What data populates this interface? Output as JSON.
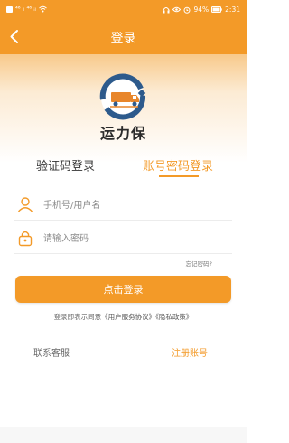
{
  "status_bar": {
    "signal_text": "⁴⁶ ᵢₗ ⁴⁶ ᵢₗ",
    "battery": "94%",
    "time": "2:31"
  },
  "nav": {
    "title": "登录",
    "back_icon": "chevron-left-icon"
  },
  "brand": {
    "app_name": "运力保",
    "logo_icon": "truck-logo-icon"
  },
  "tabs": {
    "code_login": "验证码登录",
    "password_login": "账号密码登录",
    "active": "password_login"
  },
  "form": {
    "phone_placeholder": "手机号/用户名",
    "phone_value": "",
    "password_placeholder": "请输入密码",
    "password_value": "",
    "forgot_password": "忘记密码?",
    "login_button": "点击登录"
  },
  "agreement": {
    "prefix": "登录即表示同意",
    "user_agreement": "《用户服务协议》",
    "privacy_policy": "《隐私政策》"
  },
  "footer": {
    "contact": "联系客服",
    "register": "注册账号"
  },
  "colors": {
    "accent": "#f39a28",
    "text_dark": "#2b2b2b",
    "text_muted": "#8a8a8a"
  }
}
